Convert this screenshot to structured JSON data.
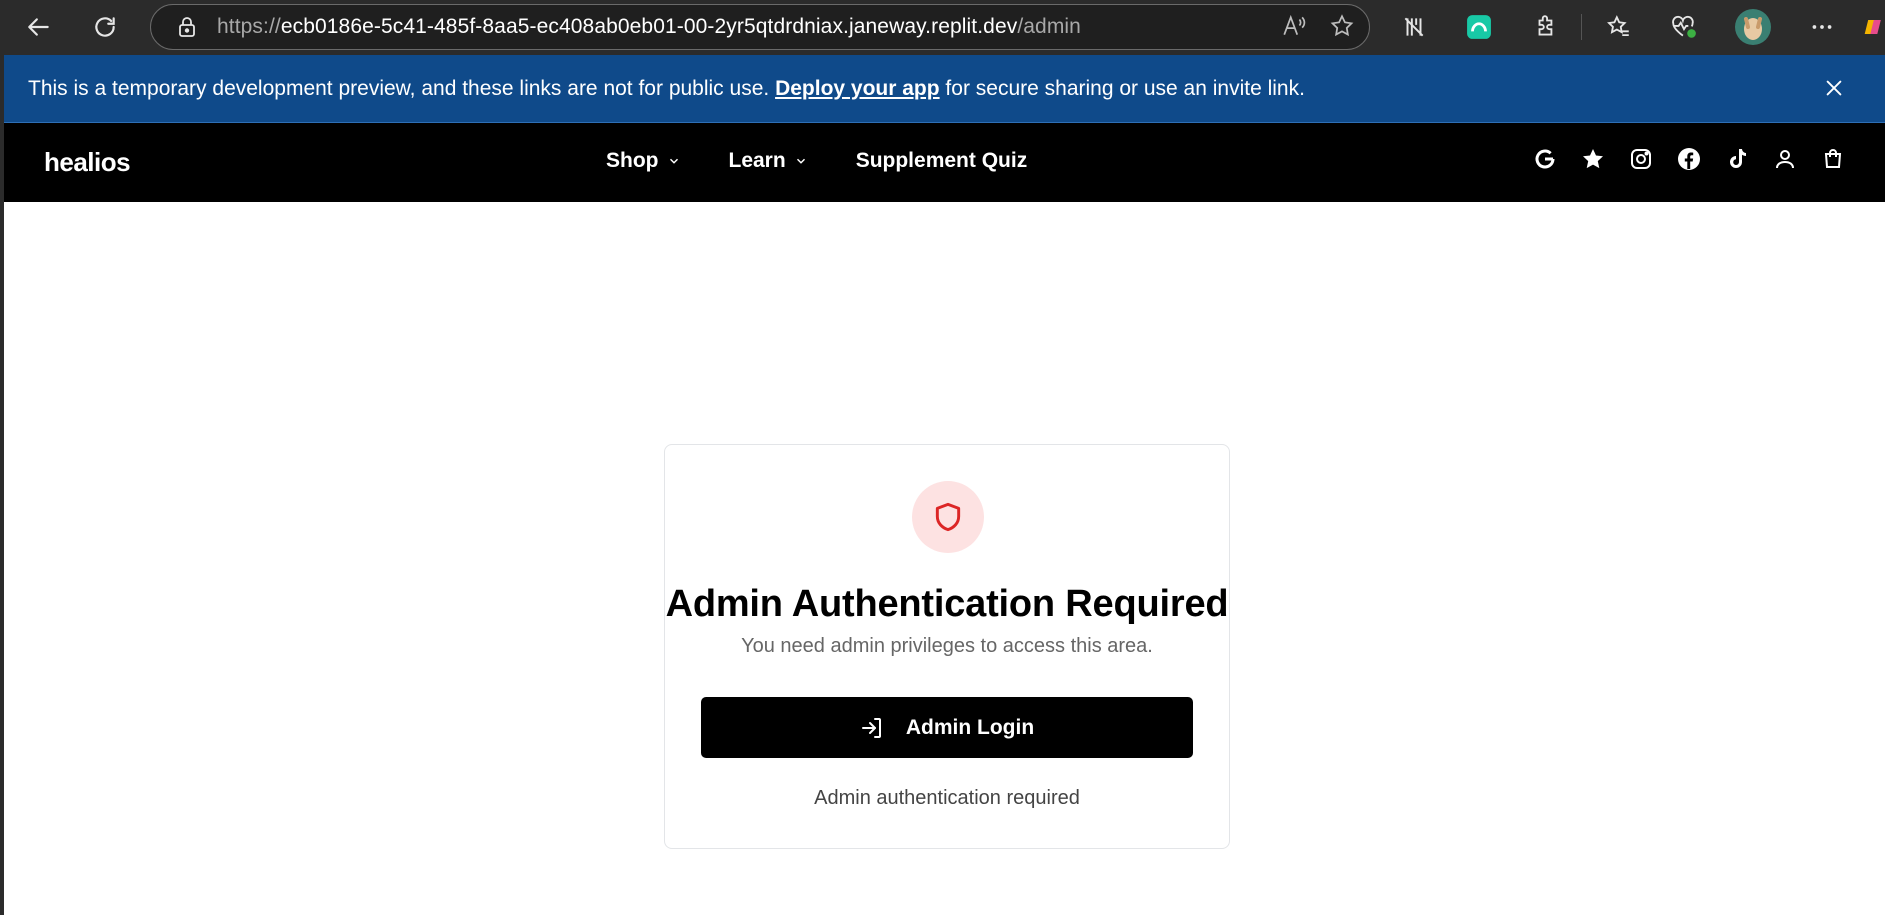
{
  "browser": {
    "url_prefix": "https://",
    "url_host": "ecb0186e-5c41-485f-8aa5-ec408ab0eb01-00-2yr5qtdrdniax.janeway.replit.dev",
    "url_path": "/admin"
  },
  "banner": {
    "text_before": "This is a temporary development preview, and these links are not for public use. ",
    "link_text": "Deploy your app",
    "text_after": " for secure sharing or use an invite link."
  },
  "header": {
    "logo": "healios",
    "menu": [
      {
        "label": "Shop"
      },
      {
        "label": "Learn"
      },
      {
        "label": "Supplement Quiz"
      }
    ],
    "icons": [
      "google-icon",
      "star-icon",
      "instagram-icon",
      "facebook-icon",
      "tiktok-icon",
      "user-icon",
      "cart-icon"
    ]
  },
  "auth_card": {
    "title": "Admin Authentication Required",
    "subtitle": "You need admin privileges to access this area.",
    "button_label": "Admin Login",
    "footer_text": "Admin authentication required"
  },
  "colors": {
    "banner_bg": "#0f4a8a",
    "header_bg": "#000000",
    "shield": "#dc2626",
    "shield_bg": "#fde2e2"
  }
}
